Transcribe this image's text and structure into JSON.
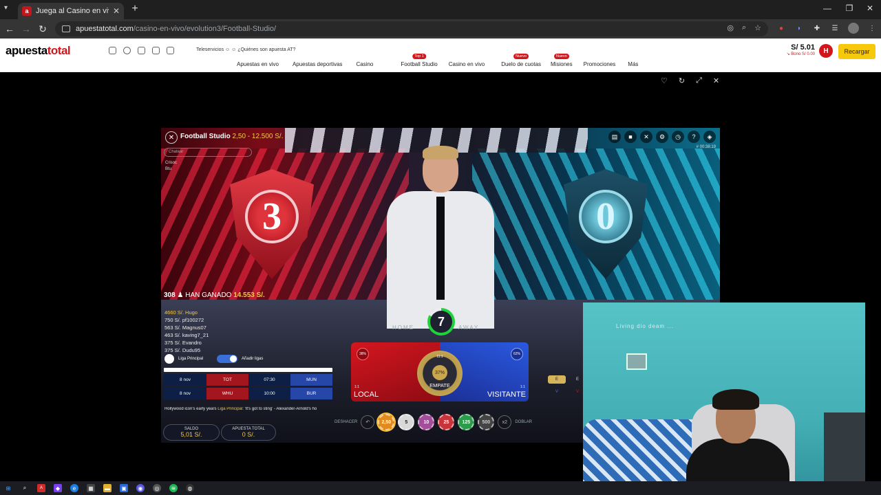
{
  "browser": {
    "tab_title": "Juega al Casino en vivo Online",
    "tab_favicon": "a",
    "tab_close": "✕",
    "new_tab": "+",
    "url_host": "apuestatotal.com",
    "url_path": "/casino-en-vivo/evolution3/Football-Studio/"
  },
  "site": {
    "logo_part1": "apuesta",
    "logo_part2": "total",
    "teleservicios": "Teleservicios ☺ ☺   ¿Quiénes son apuesta AT?",
    "menu": [
      {
        "label": "Apuestas en vivo",
        "badge": ""
      },
      {
        "label": "Apuestas deportivas",
        "badge": ""
      },
      {
        "label": "Casino",
        "badge": ""
      },
      {
        "label": "Football Studio",
        "badge": "Top 1"
      },
      {
        "label": "Casino en vivo",
        "badge": ""
      },
      {
        "label": "Duelo de cuotas",
        "badge": "Nuevo"
      },
      {
        "label": "Misiones",
        "badge": "Nuevo"
      },
      {
        "label": "Promociones",
        "badge": ""
      },
      {
        "label": "Más",
        "badge": ""
      }
    ],
    "balance": "S/ 5.01",
    "bonus": "↘ Bono S/ 0.00",
    "avatar_letter": "H",
    "recargar": "Recargar"
  },
  "game": {
    "name": "Football Studio",
    "limits": "2,50 - 12.500 S/.",
    "round_id": "# 00:38:19",
    "chat_placeholder": "Chatear",
    "chat_user": "Crisoc",
    "chat_text": "Btu",
    "home_score": "3",
    "away_score": "0",
    "winners_count": "308",
    "winners_label": "HAN GANADO",
    "winners_amount": "14.553 S/.",
    "winners": [
      {
        "amount": "4660 S/.",
        "name": "Hugo"
      },
      {
        "amount": "750 S/.",
        "name": "pf100272"
      },
      {
        "amount": "563 S/.",
        "name": "Magnus07"
      },
      {
        "amount": "463 S/.",
        "name": "kaving7_21"
      },
      {
        "amount": "375 S/.",
        "name": "Evandro"
      },
      {
        "amount": "375 S/.",
        "name": "Dudu95"
      }
    ],
    "league_label": "Liga Principal",
    "add_leagues": "Añadir ligas",
    "matches": [
      {
        "date": "8 nov",
        "home": "TOT",
        "time": "07:30",
        "away": "MUN"
      },
      {
        "date": "8 nov",
        "home": "WHU",
        "time": "10:00",
        "away": "BUR"
      }
    ],
    "ticker_pre": "Hollywood icon's early years",
    "ticker_hl": "Liga Principal:",
    "ticker_post": "'It's got to sting' - Alexander-Arnold's ho",
    "timer": "7",
    "board_home": "HOME",
    "board_away": "AWAY",
    "timer_progress": 0.83,
    "local_label": "LOCAL",
    "local_pct": "38%",
    "local_odds": "1:1",
    "draw_label": "EMPATE",
    "draw_pct": "37%",
    "draw_odds": "11:1",
    "visit_label": "VISITANTE",
    "visit_pct": "62%",
    "visit_odds": "1:1",
    "side_e": "E",
    "side_e2": "E",
    "side_v": "V",
    "side_v2": "V",
    "undo_label": "DESHACER",
    "double_label": "DOBLAR",
    "double_x": "x2",
    "chips": [
      "2,50",
      "5",
      "10",
      "25",
      "125",
      "500"
    ],
    "saldo_label": "SALDO",
    "saldo_value": "5,01 S/.",
    "apuesta_label": "APUESTA TOTAL",
    "apuesta_value": "0 S/."
  },
  "webcam": {
    "wall_text": "Living  dio  deam  ..."
  },
  "colors": {
    "brand_red": "#d3151c",
    "recargar_yellow": "#f7c90c",
    "gold": "#f1c94b"
  }
}
